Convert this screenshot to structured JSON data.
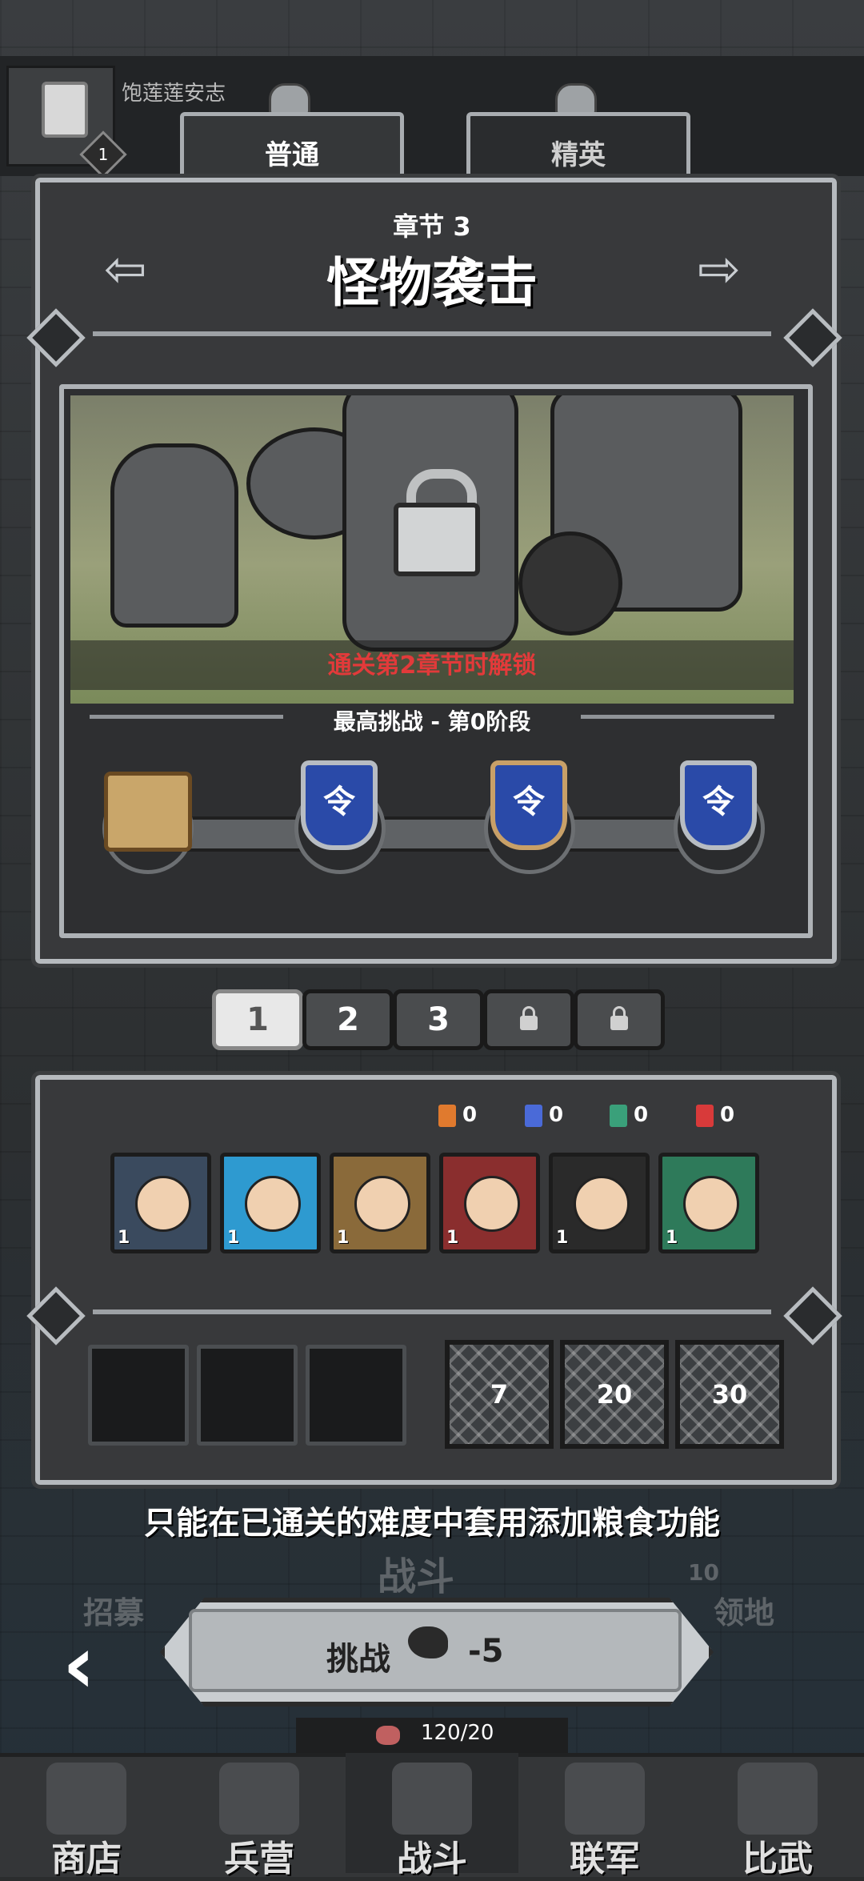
{
  "player": {
    "name": "饱莲莲安志",
    "level": "1"
  },
  "tabs": [
    {
      "label": "普通"
    },
    {
      "label": "精英"
    }
  ],
  "chapter": {
    "number_label": "章节 3",
    "title": "怪物袭击",
    "unlock_hint": "通关第2章节时解锁",
    "best_challenge": "最高挑战 - 第0阶段"
  },
  "progress_nodes": [
    {
      "icon": "scroll-icon"
    },
    {
      "icon": "command-token-icon",
      "glyph": "令"
    },
    {
      "icon": "command-token-icon",
      "glyph": "令"
    },
    {
      "icon": "command-token-icon",
      "glyph": "令"
    }
  ],
  "levels": [
    {
      "label": "1",
      "active": true
    },
    {
      "label": "2"
    },
    {
      "label": "3"
    },
    {
      "label": "",
      "locked": true
    },
    {
      "label": "",
      "locked": true
    }
  ],
  "stats": [
    {
      "icon": "attack-icon",
      "value": "0",
      "color": "#e07a2e"
    },
    {
      "icon": "defense-icon",
      "value": "0",
      "color": "#4a6ad8"
    },
    {
      "icon": "speed-icon",
      "value": "0",
      "color": "#3aa07a"
    },
    {
      "icon": "health-icon",
      "value": "0",
      "color": "#d83a3a"
    }
  ],
  "heroes": [
    {
      "level": "1",
      "color": "#3a4a5e"
    },
    {
      "level": "1",
      "color": "#2e9ad0"
    },
    {
      "level": "1",
      "color": "#8a6a3a"
    },
    {
      "level": "1",
      "color": "#8a2e2e"
    },
    {
      "level": "1",
      "color": "#2a2a2a"
    },
    {
      "level": "1",
      "color": "#2e7a5a"
    }
  ],
  "locked_slots": [
    {
      "label": "7"
    },
    {
      "label": "20"
    },
    {
      "label": "30"
    }
  ],
  "tip": "只能在已通关的难度中套用添加粮食功能",
  "ghost_labels": {
    "battle": "战斗",
    "recruit": "招募",
    "territory": "领地",
    "territory_count": "10"
  },
  "challenge": {
    "label": "挑战",
    "cost": "-5"
  },
  "food": {
    "value": "120/20"
  },
  "nav": [
    {
      "label": "商店"
    },
    {
      "label": "兵营"
    },
    {
      "label": "战斗"
    },
    {
      "label": "联军"
    },
    {
      "label": "比武"
    }
  ],
  "colors": {
    "accent_red": "#e23a3a",
    "panel": "#38393b",
    "frame": "#b6babe"
  }
}
